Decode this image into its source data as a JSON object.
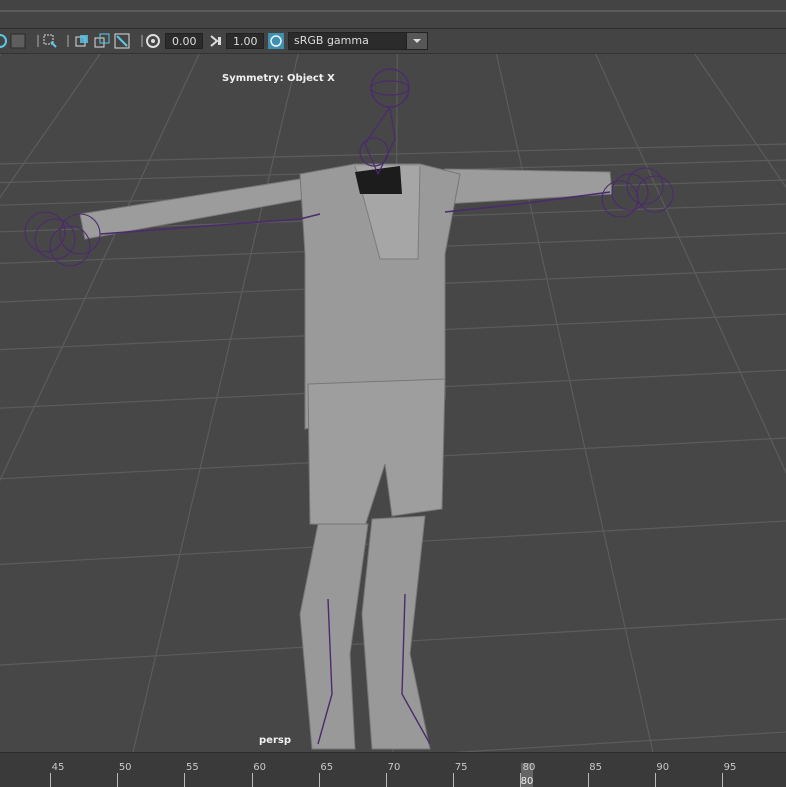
{
  "toolbar": {
    "exposure_value": "0.00",
    "gamma_value": "1.00",
    "colorspace_select": "sRGB gamma",
    "icons": [
      "camera-attribute-icon",
      "grid-toggle-icon",
      "select-camera-icon",
      "film-gate-icon",
      "resolution-gate-icon",
      "gate-mask-icon",
      "safe-action-icon",
      "exposure-icon",
      "gamma-icon",
      "color-management-icon",
      "dropdown-arrow-icon"
    ]
  },
  "viewport": {
    "symmetry_label": "Symmetry: Object X",
    "camera_label": "persp",
    "colors": {
      "background": "#474747",
      "grid": "#5c5c5c",
      "mesh": "#9a9a9a",
      "rig": "#4b2a6e"
    }
  },
  "timeline": {
    "ticks": [
      "45",
      "50",
      "55",
      "60",
      "65",
      "70",
      "75",
      "80",
      "85",
      "90",
      "95"
    ],
    "current_frame": "80"
  }
}
